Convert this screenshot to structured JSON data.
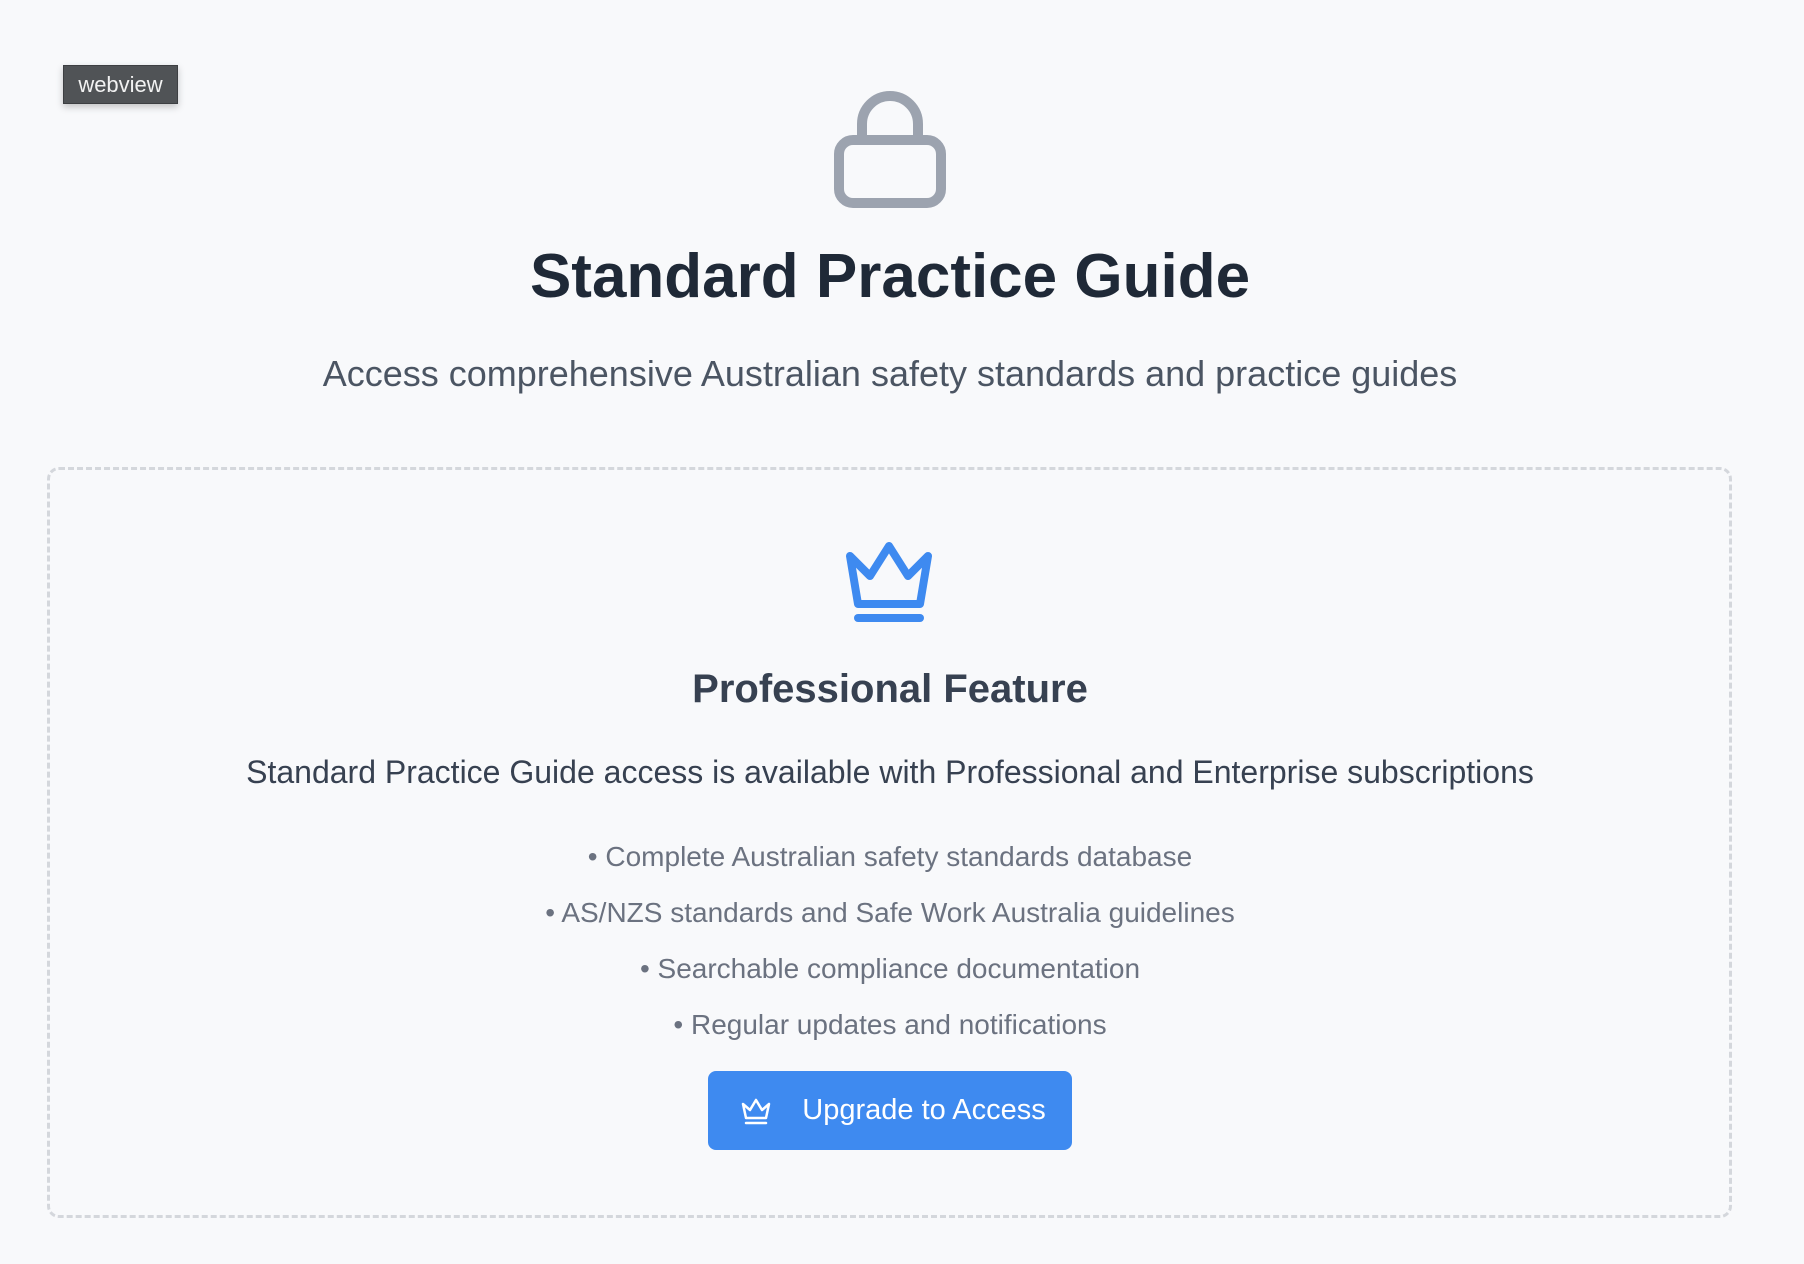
{
  "debug_tag": "webview",
  "header": {
    "icon": "lock-icon",
    "title": "Standard Practice Guide",
    "subtitle": "Access comprehensive Australian safety standards and practice guides"
  },
  "feature_card": {
    "icon": "crown-icon",
    "title": "Professional Feature",
    "description": "Standard Practice Guide access is available with Professional and Enterprise subscriptions",
    "features": [
      "• Complete Australian safety standards database",
      "• AS/NZS standards and Safe Work Australia guidelines",
      "• Searchable compliance documentation",
      "• Regular updates and notifications"
    ],
    "button": {
      "icon": "crown-icon",
      "label": "Upgrade to Access"
    }
  },
  "colors": {
    "background": "#f8f9fb",
    "accent": "#3e8af0",
    "title": "#1f2937",
    "muted_icon": "#9ca3af",
    "card_border": "#d4d7dc"
  }
}
